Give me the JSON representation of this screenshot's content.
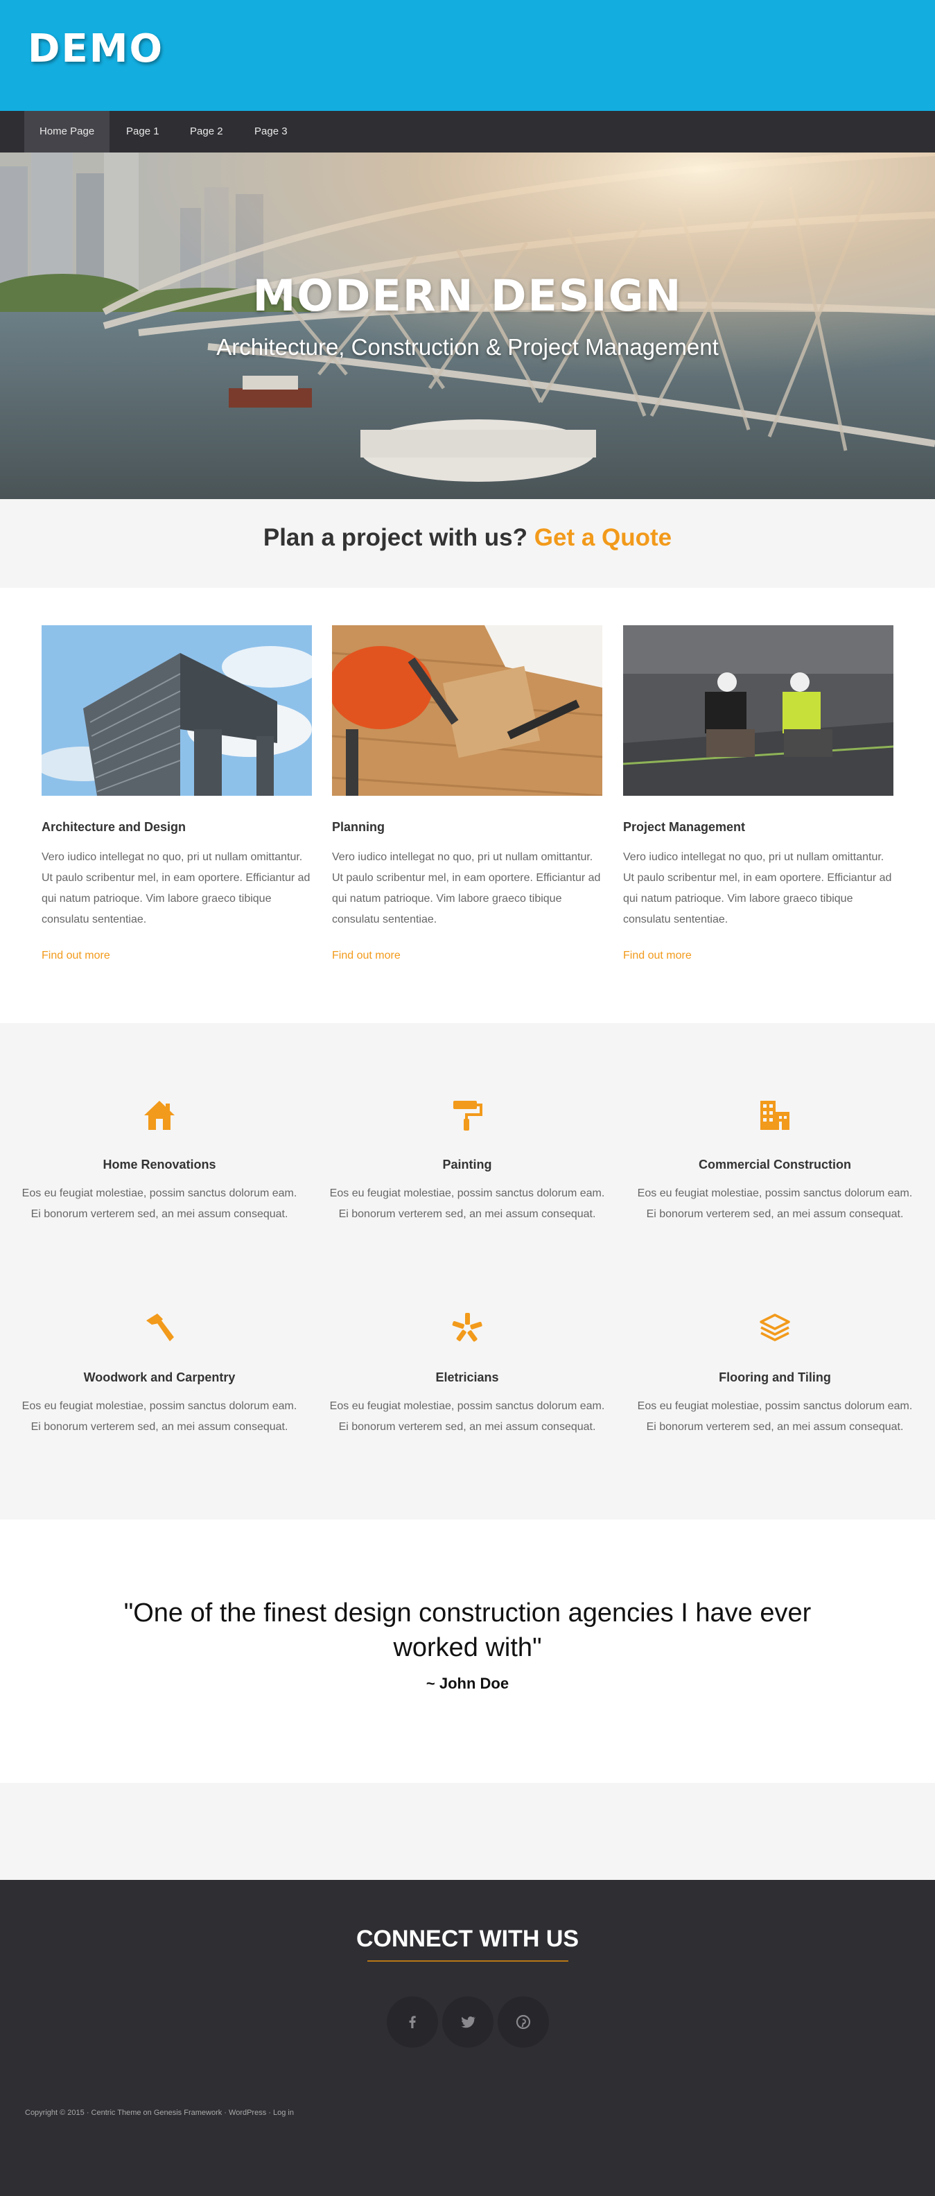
{
  "header": {
    "logo": "DEMO"
  },
  "nav": {
    "items": [
      "Home Page",
      "Page 1",
      "Page 2",
      "Page 3"
    ],
    "active": "Home Page"
  },
  "hero": {
    "title": "MODERN DESIGN",
    "subtitle": "Architecture, Construction & Project Management"
  },
  "cta": {
    "text": "Plan a project with us?",
    "highlight": "Get a Quote"
  },
  "cards": [
    {
      "title": "Architecture and Design",
      "body": "Vero iudico intellegat no quo, pri ut nullam omittantur. Ut paulo scribentur mel, in eam oportere. Efficiantur ad qui natum patrioque. Vim labore graeco tibique consulatu sententiae.",
      "link": "Find out more"
    },
    {
      "title": "Planning",
      "body": "Vero iudico intellegat no quo, pri ut nullam omittantur. Ut paulo scribentur mel, in eam oportere. Efficiantur ad qui natum patrioque. Vim labore graeco tibique consulatu sententiae.",
      "link": "Find out more"
    },
    {
      "title": "Project Management",
      "body": "Vero iudico intellegat no quo, pri ut nullam omittantur. Ut paulo scribentur mel, in eam oportere. Efficiantur ad qui natum patrioque. Vim labore graeco tibique consulatu sententiae.",
      "link": "Find out more"
    }
  ],
  "services": [
    {
      "icon": "home-icon",
      "title": "Home Renovations",
      "body": "Eos eu feugiat molestiae, possim sanctus dolorum eam. Ei bonorum verterem sed, an mei assum consequat."
    },
    {
      "icon": "paint-roller-icon",
      "title": "Painting",
      "body": "Eos eu feugiat molestiae, possim sanctus dolorum eam. Ei bonorum verterem sed, an mei assum consequat."
    },
    {
      "icon": "building-icon",
      "title": "Commercial Construction",
      "body": "Eos eu feugiat molestiae, possim sanctus dolorum eam. Ei bonorum verterem sed, an mei assum consequat."
    },
    {
      "icon": "hammer-icon",
      "title": "Woodwork and Carpentry",
      "body": "Eos eu feugiat molestiae, possim sanctus dolorum eam. Ei bonorum verterem sed, an mei assum consequat."
    },
    {
      "icon": "spark-icon",
      "title": "Eletricians",
      "body": "Eos eu feugiat molestiae, possim sanctus dolorum eam. Ei bonorum verterem sed, an mei assum consequat."
    },
    {
      "icon": "layers-icon",
      "title": "Flooring and Tiling",
      "body": "Eos eu feugiat molestiae, possim sanctus dolorum eam. Ei bonorum verterem sed, an mei assum consequat."
    }
  ],
  "testimonial": {
    "quote": "\"One of the finest design construction agencies I have ever worked with\"",
    "author": "~ John Doe"
  },
  "footer": {
    "connect_title": "CONNECT WITH US",
    "social": [
      "facebook-icon",
      "twitter-icon",
      "pinterest-icon"
    ],
    "copyright": "Copyright © 2015 · Centric Theme on Genesis Framework · WordPress · Log in"
  },
  "colors": {
    "header": "#13addf",
    "nav": "#2e2e33",
    "accent": "#f29a1b",
    "footer": "#2e2e33",
    "light_band": "#f5f5f5"
  }
}
